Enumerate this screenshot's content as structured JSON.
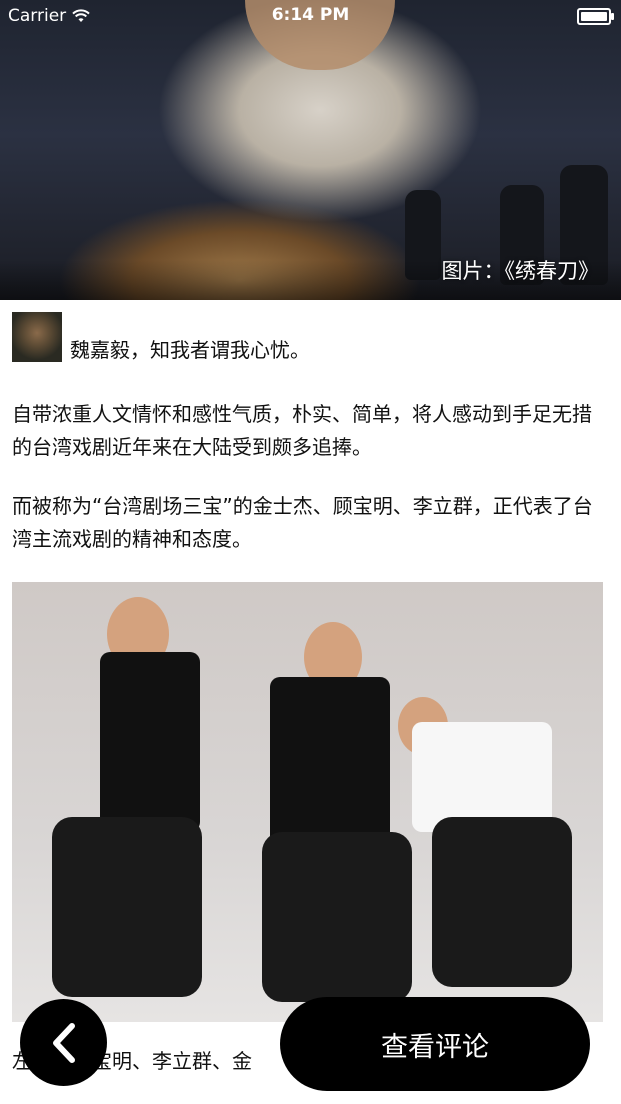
{
  "status_bar": {
    "carrier": "Carrier",
    "time": "6:14 PM",
    "battery_level": 1.0
  },
  "hero": {
    "caption": "图片：《绣春刀》"
  },
  "author": {
    "name_line": "魏嘉毅，知我者谓我心忧。"
  },
  "article": {
    "paragraph_1": "自带浓重人文情怀和感性气质，朴实、简单，将人感动到手足无措的台湾戏剧近年来在大陆受到颇多追捧。",
    "paragraph_2": "而被称为“台湾剧场三宝”的金士杰、顾宝明、李立群，正代表了台湾主流戏剧的精神和态度。",
    "photo_caption_visible": "左起：顾宝明、李立群、金"
  },
  "actions": {
    "back_icon": "chevron-left-icon",
    "comments_label": "查看评论"
  }
}
